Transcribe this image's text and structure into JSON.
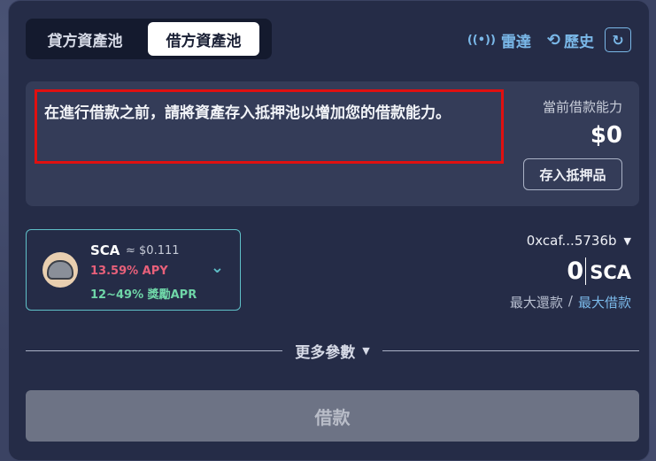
{
  "tabs": [
    {
      "label": "貸方資產池",
      "active": false
    },
    {
      "label": "借方資產池",
      "active": true
    }
  ],
  "header": {
    "radar_label": "雷達",
    "radar_icon": "broadcast-icon",
    "history_label": "歷史",
    "history_icon": "history-icon",
    "refresh_icon": "refresh-icon"
  },
  "info": {
    "notice": "在進行借款之前，請將資產存入抵押池以增加您的借款能力。",
    "capacity_label": "當前借款能力",
    "capacity_value": "$0",
    "deposit_button": "存入抵押品"
  },
  "token": {
    "symbol": "SCA",
    "price": "≈ $0.111",
    "apy": "13.59% APY",
    "reward_apr": "12~49% 獎勵APR",
    "logo_icon": "sca-shell-icon",
    "chevron_icon": "chevron-down-icon"
  },
  "amount": {
    "wallet": "0xcaf...5736b",
    "value": "0",
    "unit": "SCA",
    "max_repay": "最大還款",
    "separator": "/",
    "max_borrow": "最大借款"
  },
  "more_params": "更多參數",
  "borrow_button": "借款",
  "colors": {
    "card_bg": "#252c47",
    "accent_blue": "#7ab8e8",
    "accent_teal": "#5fc0c8",
    "apy_red": "#e8607a",
    "apr_green": "#6fd6a8",
    "notice_highlight": "#e01010"
  }
}
